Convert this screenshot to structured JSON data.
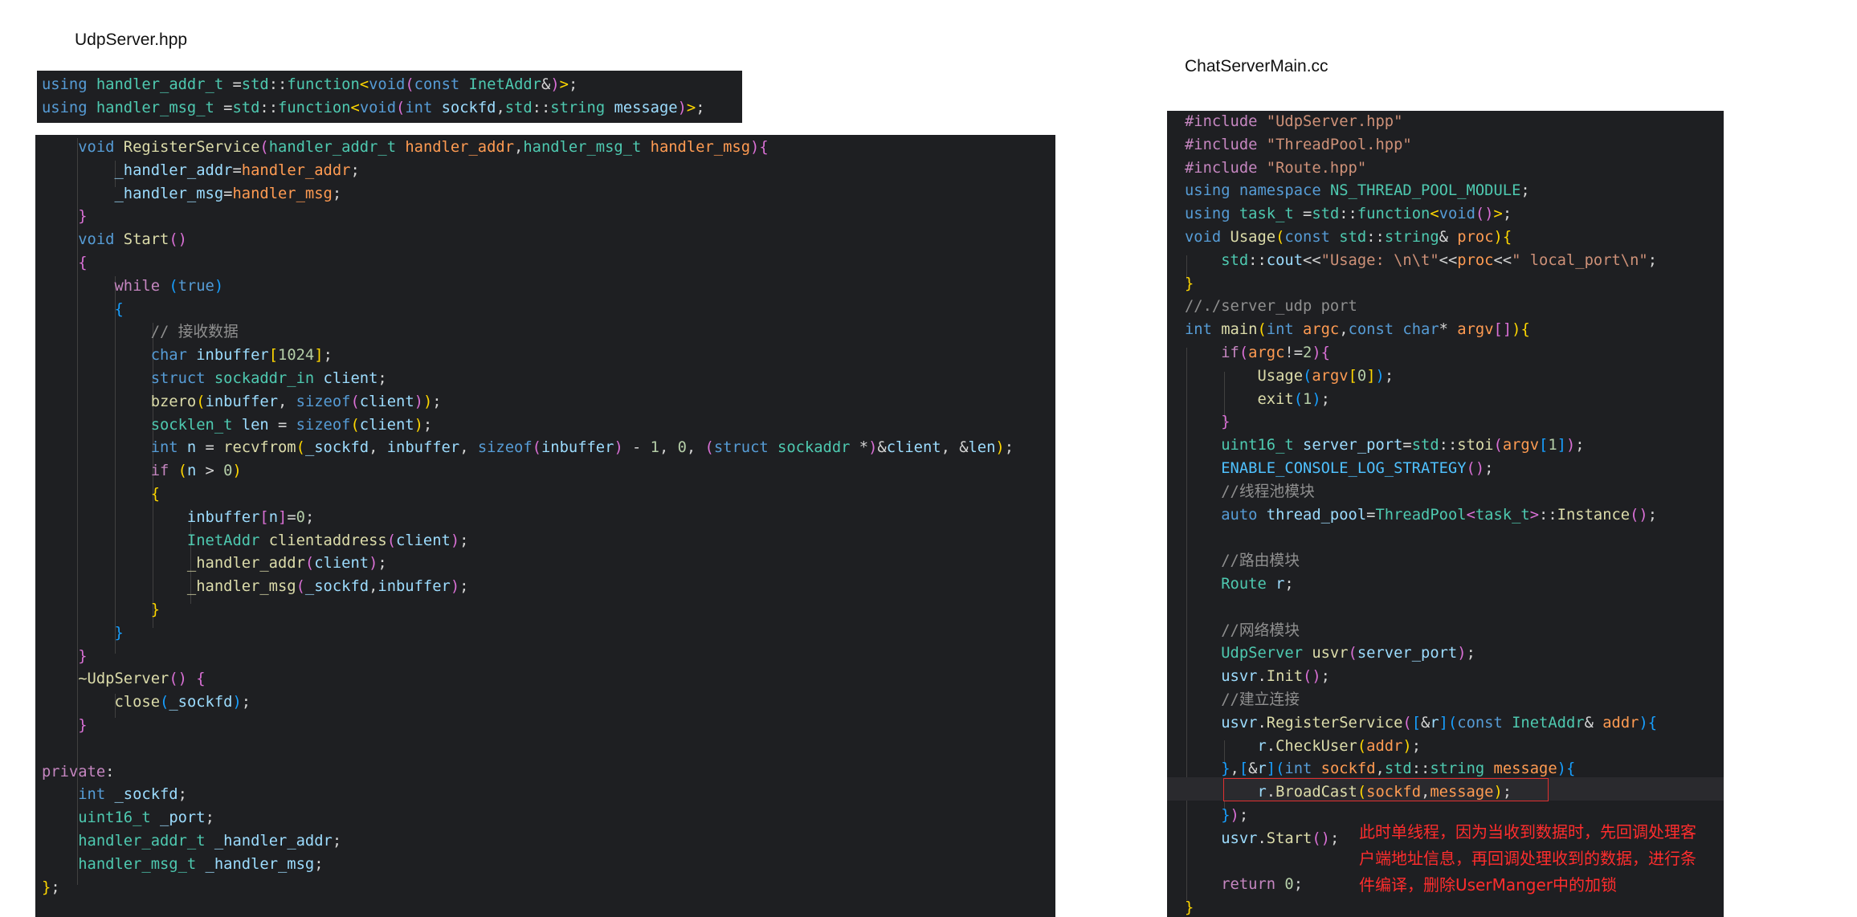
{
  "titles": {
    "left": "UdpServer.hpp",
    "right": "ChatServerMain.cc"
  },
  "typedefs": [
    "using handler_addr_t =std::function<void(const InetAddr&)>;",
    "using handler_msg_t =std::function<void(int sockfd,std::string message)>;"
  ],
  "udp_server_code": [
    "    void RegisterService(handler_addr_t handler_addr,handler_msg_t handler_msg){",
    "        _handler_addr=handler_addr;",
    "        _handler_msg=handler_msg;",
    "    }",
    "    void Start()",
    "    {",
    "        while (true)",
    "        {",
    "            // 接收数据",
    "            char inbuffer[1024];",
    "            struct sockaddr_in client;",
    "            bzero(inbuffer, sizeof(client));",
    "            socklen_t len = sizeof(client);",
    "            int n = recvfrom(_sockfd, inbuffer, sizeof(inbuffer) - 1, 0, (struct sockaddr *)&client, &len);",
    "            if (n > 0)",
    "            {",
    "                inbuffer[n]=0;",
    "                InetAddr clientaddress(client);",
    "                _handler_addr(client);",
    "                _handler_msg(_sockfd,inbuffer);",
    "            }",
    "        }",
    "    }",
    "    ~UdpServer() {",
    "        close(_sockfd);",
    "    }",
    "",
    "private:",
    "    int _sockfd;",
    "    uint16_t _port;",
    "    handler_addr_t _handler_addr;",
    "    handler_msg_t _handler_msg;",
    "};"
  ],
  "main_code": [
    "#include \"UdpServer.hpp\"",
    "#include \"ThreadPool.hpp\"",
    "#include \"Route.hpp\"",
    "using namespace NS_THREAD_POOL_MODULE;",
    "using task_t =std::function<void()>;",
    "void Usage(const std::string& proc){",
    "    std::cout<<\"Usage: \\n\\t\"<<proc<<\" local_port\\n\";",
    "}",
    "//./server_udp port",
    "int main(int argc,const char* argv[]){",
    "    if(argc!=2){",
    "        Usage(argv[0]);",
    "        exit(1);",
    "    }",
    "    uint16_t server_port=std::stoi(argv[1]);",
    "    ENABLE_CONSOLE_LOG_STRATEGY();",
    "    //线程池模块",
    "    auto thread_pool=ThreadPool<task_t>::Instance();",
    "",
    "    //路由模块",
    "    Route r;",
    "",
    "    //网络模块",
    "    UdpServer usvr(server_port);",
    "    usvr.Init();",
    "    //建立连接",
    "    usvr.RegisterService([&r](const InetAddr& addr){",
    "        r.CheckUser(addr);",
    "    },[&r](int sockfd,std::string message){",
    "        r.BroadCast(sockfd,message);",
    "    });",
    "    usvr.Start();",
    "",
    "    return 0;",
    "}"
  ],
  "annotation": {
    "lines": [
      "此时单线程，因为当收到数据时，先回调处理客",
      "户端地址信息，再回调处理收到的数据，进行条",
      "件编译，删除UserManger中的加锁"
    ],
    "color": "#ff2d2d"
  },
  "colors": {
    "editor_bg": "#1e1f22",
    "keyword": "#569cd6",
    "type": "#4ec9b0",
    "function": "#dcdcaa",
    "string": "#ce9178",
    "comment": "#8f8f8f",
    "highlight_box": "#e03030"
  }
}
